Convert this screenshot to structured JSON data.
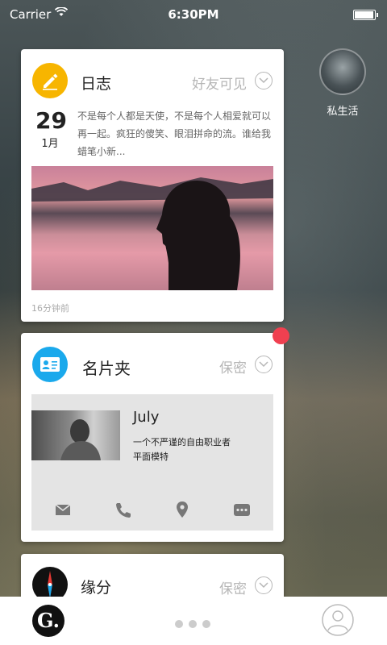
{
  "status_bar": {
    "carrier": "Carrier",
    "time": "6:30PM"
  },
  "avatar": {
    "label": "私生活"
  },
  "diary_card": {
    "title": "日志",
    "privacy": "好友可见",
    "date_day": "29",
    "date_month": "1月",
    "text": "不是每个人都是天使，不是每个人相爱就可以再一起。疯狂的傻笑、眼泪拼命的流。谁给我蜡笔小新...",
    "time_ago": "16分钟前",
    "icon": "pencil-icon",
    "icon_color": "#f7b500"
  },
  "contact_card": {
    "title": "名片夹",
    "privacy": "保密",
    "name": "July",
    "desc_line1": "一个不严谨的自由职业者",
    "desc_line2": "平面模特",
    "icon": "id-card-icon",
    "icon_color": "#1aa9ec",
    "actions": [
      "mail-icon",
      "phone-icon",
      "location-icon",
      "message-icon"
    ],
    "badge_color": "#f04050"
  },
  "fate_card": {
    "title": "缘分",
    "privacy": "保密",
    "icon": "compass-icon"
  },
  "tab_bar": {
    "logo": "G.",
    "page_count": 3,
    "profile_icon": "user-icon"
  }
}
